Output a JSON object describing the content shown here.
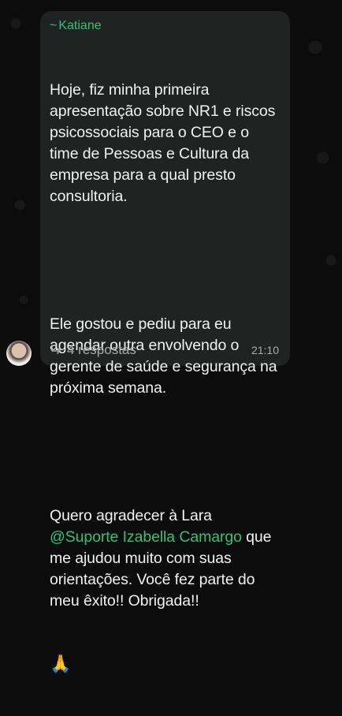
{
  "message": {
    "sender": "Katiane",
    "sender_prefix": "~",
    "paragraph1": "Hoje, fiz minha primeira apresentação sobre NR1 e riscos psicossociais para o CEO e o time de Pessoas e Cultura da empresa para a qual presto consultoria.",
    "paragraph2": "Ele gostou e pediu para eu agendar outra envolvendo o gerente de saúde e segurança na próxima semana.",
    "paragraph3_before": "Quero agradecer à Lara ",
    "mention": "@Suporte Izabella Camargo",
    "paragraph3_after": " que me ajudou muito com suas orientações. Você fez parte do meu êxito!! Obrigada!!",
    "emoji": "🙏",
    "replies": "4 respostas",
    "time": "21:10"
  },
  "colors": {
    "accent": "#2fc37a",
    "bubble": "#1f2322",
    "background": "#0b0c0b"
  }
}
